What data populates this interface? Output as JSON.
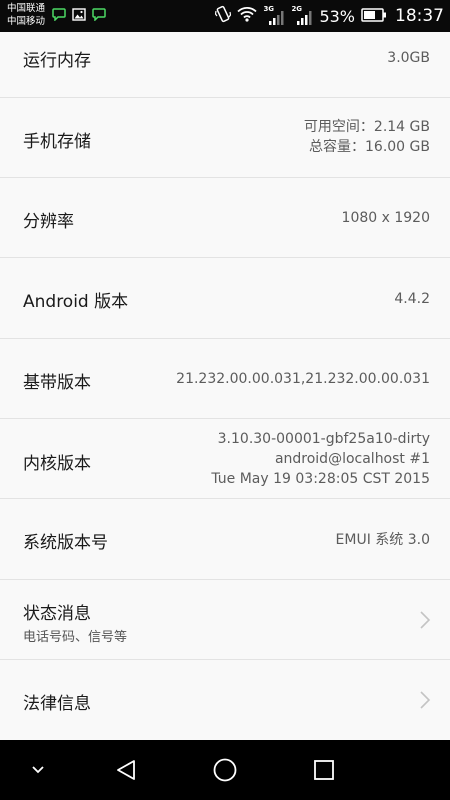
{
  "status_bar": {
    "carrier_1": "中国联通",
    "carrier_2": "中国移动",
    "network_1": "3G",
    "network_2": "2G",
    "battery_percent": "53%",
    "time": "18:37",
    "icons": [
      "wechat-icon",
      "image-icon",
      "wechat-icon",
      "vibrate-icon",
      "wifi-icon",
      "signal-icon",
      "signal-icon",
      "battery-icon"
    ]
  },
  "rows": [
    {
      "label": "运行内存",
      "values": [
        "3.0GB"
      ]
    },
    {
      "label": "手机存储",
      "values": [
        "可用空间：2.14 GB",
        "总容量：16.00 GB"
      ]
    },
    {
      "label": "分辨率",
      "values": [
        "1080 x 1920"
      ]
    },
    {
      "label": "Android 版本",
      "values": [
        "4.4.2"
      ]
    },
    {
      "label": "基带版本",
      "values": [
        "21.232.00.00.031,21.232.00.00.031"
      ]
    },
    {
      "label": "内核版本",
      "values": [
        "3.10.30-00001-gbf25a10-dirty",
        "android@localhost #1",
        "Tue May 19 03:28:05 CST 2015"
      ]
    },
    {
      "label": "系统版本号",
      "values": [
        "EMUI 系统 3.0"
      ]
    },
    {
      "label": "状态消息",
      "sublabel": "电话号码、信号等",
      "icon": "chevron-right-icon"
    },
    {
      "label": "法律信息",
      "icon": "chevron-right-icon"
    }
  ],
  "nav_bar": {
    "icons": [
      "chevron-down-icon",
      "back-icon",
      "home-icon",
      "recents-icon"
    ]
  }
}
